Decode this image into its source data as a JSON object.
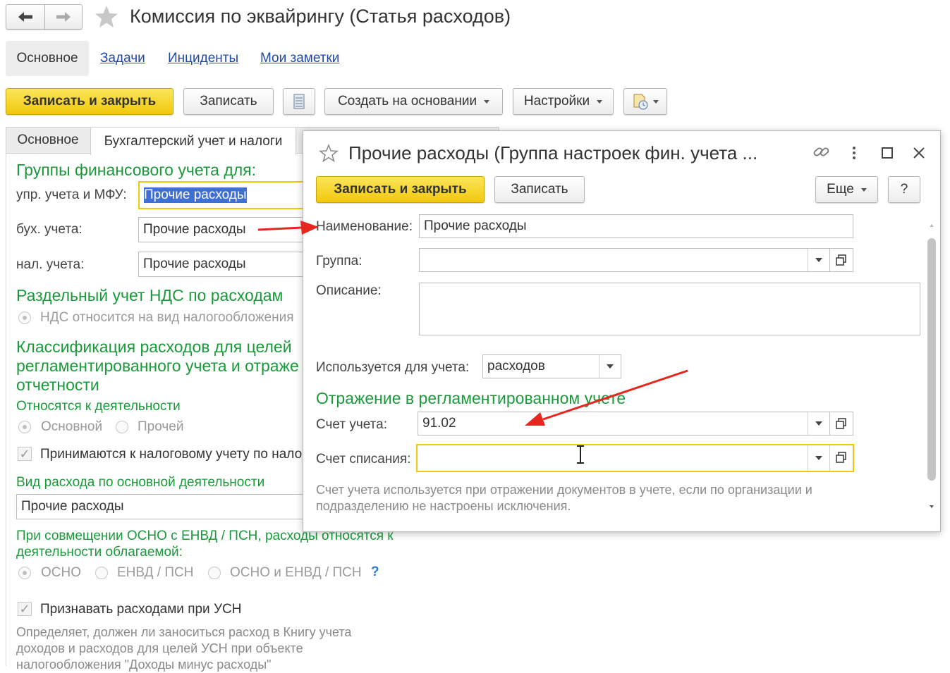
{
  "main_window": {
    "title": "Комиссия по эквайрингу (Статья расходов)",
    "nav_tabs": [
      {
        "label": "Основное"
      },
      {
        "label": "Задачи"
      },
      {
        "label": "Инциденты"
      },
      {
        "label": "Мои заметки"
      }
    ],
    "toolbar": {
      "save_close": "Записать и закрыть",
      "save": "Записать",
      "create_based": "Создать на основании",
      "settings": "Настройки"
    },
    "form_tabs": [
      {
        "label": "Основное"
      },
      {
        "label": "Бухгалтерский учет и налоги"
      }
    ],
    "groups_section": "Группы финансового учета для:",
    "upr_label": "упр. учета и МФУ:",
    "upr_value": "Прочие расходы",
    "buh_label": "бух. учета:",
    "buh_value": "Прочие расходы",
    "nal_label": "нал. учета:",
    "nal_value": "Прочие расходы",
    "vat_section": "Раздельный учет НДС по расходам",
    "vat_option": "НДС относится на вид налогообложения",
    "class_section_l1": "Классификация расходов для целей",
    "class_section_l2": "регламентированного учета и отраже",
    "class_section_l3": "отчетности",
    "activity_section": "Относятся к деятельности",
    "activity_main": "Основной",
    "activity_other": "Прочей",
    "tax_accept": "Принимаются к налоговому учету по нало",
    "expense_kind_section": "Вид расхода по основной деятельности",
    "expense_kind_value": "Прочие расходы",
    "combo_section_l1": "При совмещении ОСНО с ЕНВД / ПСН, расходы относятся к",
    "combo_section_l2": "деятельности облагаемой:",
    "opt_osno": "ОСНО",
    "opt_envd": "ЕНВД / ПСН",
    "opt_both": "ОСНО и ЕНВД / ПСН",
    "help_mark": "?",
    "usn_check": "Признавать расходами при УСН",
    "usn_hint_l1": "Определяет, должен ли заноситься расход в Книгу учета",
    "usn_hint_l2": "доходов и расходов для целей УСН при объекте",
    "usn_hint_l3": "налогообложения \"Доходы минус расходы\""
  },
  "dialog": {
    "title": "Прочие расходы (Группа настроек фин. учета ...",
    "save_close": "Записать и закрыть",
    "save": "Записать",
    "more": "Еще",
    "help": "?",
    "name_label": "Наименование:",
    "name_value": "Прочие расходы",
    "group_label": "Группа:",
    "group_value": "",
    "desc_label": "Описание:",
    "desc_value": "",
    "used_label": "Используется для учета:",
    "used_value": "расходов",
    "reflection_section": "Отражение в регламентированном учете",
    "account_label": "Счет учета:",
    "account_value": "91.02",
    "writeoff_label": "Счет списания:",
    "writeoff_value": "",
    "hint_l1": "Счет учета используется при отражении документов в учете, если по организации и",
    "hint_l2": "подразделению не настроены исключения."
  },
  "colors": {
    "accent_yellow": "#f1c80c",
    "section_green": "#1a9a3a",
    "link_blue": "#2148a8",
    "arrow_red": "#e8261e"
  }
}
